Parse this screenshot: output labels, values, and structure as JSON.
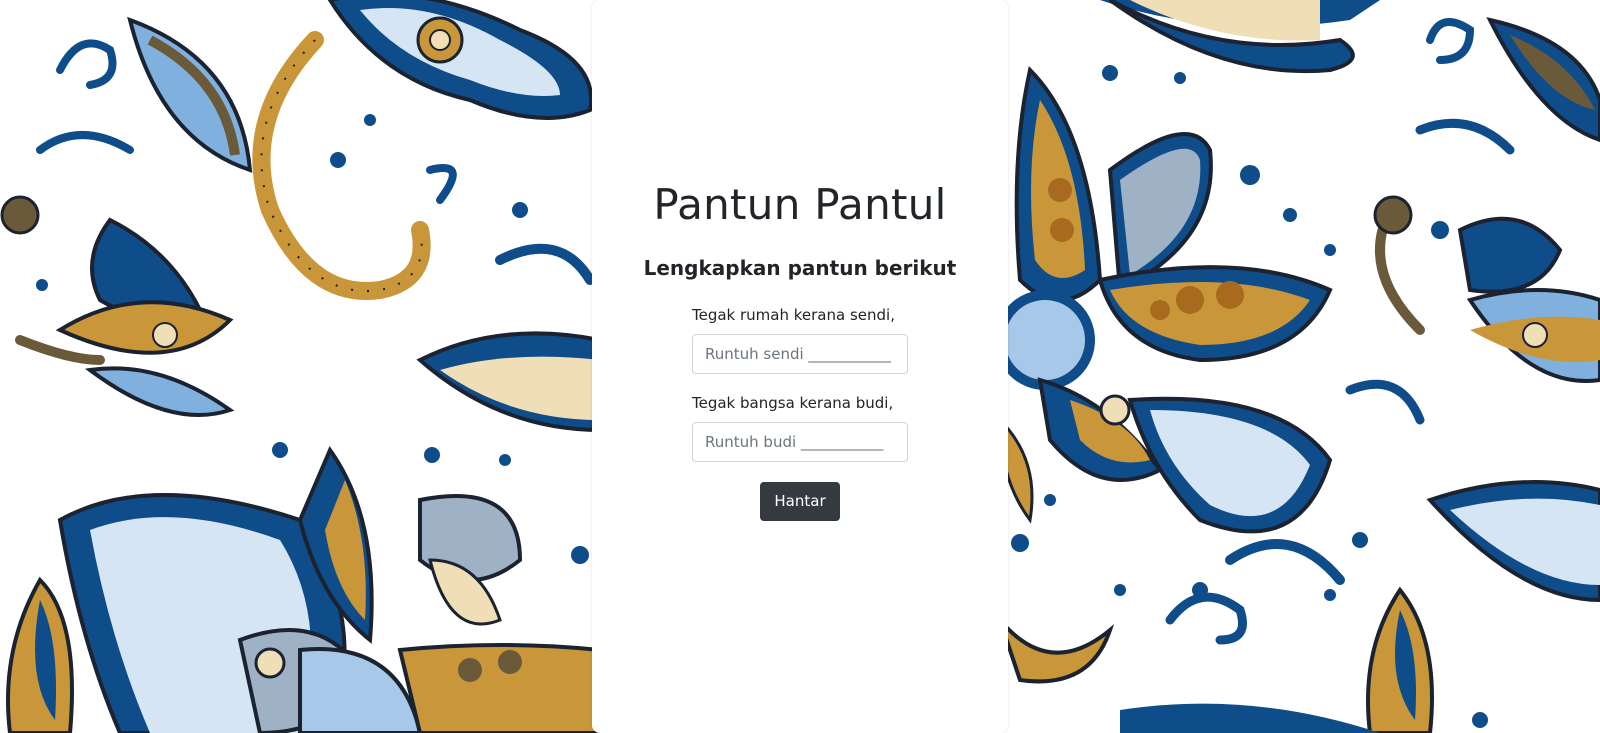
{
  "page": {
    "title": "Pantun Pantul",
    "subtitle": "Lengkapkan pantun berikut"
  },
  "form": {
    "line1_label": "Tegak rumah kerana sendi,",
    "line1_placeholder": "Runtuh sendi ___________",
    "line1_value": "",
    "line2_label": "Tegak bangsa kerana budi,",
    "line2_placeholder": "Runtuh budi ___________",
    "line2_value": "",
    "submit_label": "Hantar"
  },
  "background": {
    "motif": "batik-paisley-floral-pattern",
    "colors": {
      "navy": "#0f4c8a",
      "light_blue": "#a7c8e8",
      "pale_blue": "#d5e5f3",
      "gold": "#c9973a",
      "cream": "#f0dfb6",
      "outline": "#1b2230",
      "grey_blue": "#9fb1c5"
    }
  },
  "colors": {
    "button_bg": "#343a40",
    "text": "#212529"
  }
}
